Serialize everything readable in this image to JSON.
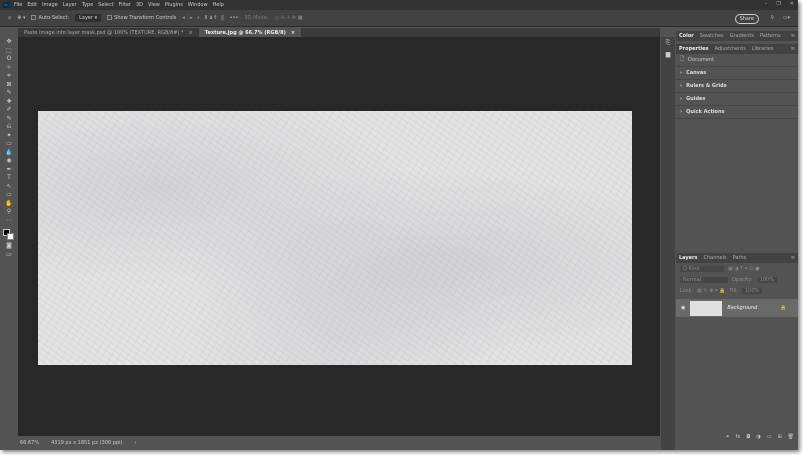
{
  "menubar": {
    "items": [
      "File",
      "Edit",
      "Image",
      "Layer",
      "Type",
      "Select",
      "Filter",
      "3D",
      "View",
      "Plugins",
      "Window",
      "Help"
    ]
  },
  "window_controls": [
    "–",
    "❐",
    "✕"
  ],
  "options": {
    "auto_select": "Auto-Select:",
    "layer_select": "Layer",
    "transform": "Show Transform Controls",
    "mode3d": "3D Mode:",
    "share": "Share"
  },
  "tabs": [
    {
      "label": "Paste image into layer mask.psd @ 100% (TEXTURE, RGB/8#) *",
      "active": false
    },
    {
      "label": "Texture.jpg @ 66.7% (RGB/8)",
      "active": true
    }
  ],
  "tools": [
    "✥",
    "⬚",
    "ʘ",
    "✧",
    "⌗",
    "⊠",
    "✎",
    "✚",
    "✐",
    "✎",
    "⎌",
    "✦",
    "▭",
    "💧",
    "◉",
    "✒",
    "T",
    "↖",
    "▭",
    "✋",
    "⚲",
    "⋯"
  ],
  "status": {
    "zoom": "66.67%",
    "dimensions": "4319 px x 1851 px (300 ppi)",
    "arrow": "›"
  },
  "color_panel": {
    "tabs": [
      "Color",
      "Swatches",
      "Gradients",
      "Patterns"
    ]
  },
  "properties_panel": {
    "tabs": [
      "Properties",
      "Adjustments",
      "Libraries"
    ],
    "document": "Document",
    "sections": [
      "Canvas",
      "Rulers & Grids",
      "Guides",
      "Quick Actions"
    ]
  },
  "layers_panel": {
    "tabs": [
      "Layers",
      "Channels",
      "Paths"
    ],
    "kind": "Q Kind",
    "blend": "Normal",
    "opacity_label": "Opacity:",
    "opacity": "100%",
    "lock": "Lock:",
    "fill_label": "Fill:",
    "fill": "100%",
    "layer_name": "Background"
  }
}
